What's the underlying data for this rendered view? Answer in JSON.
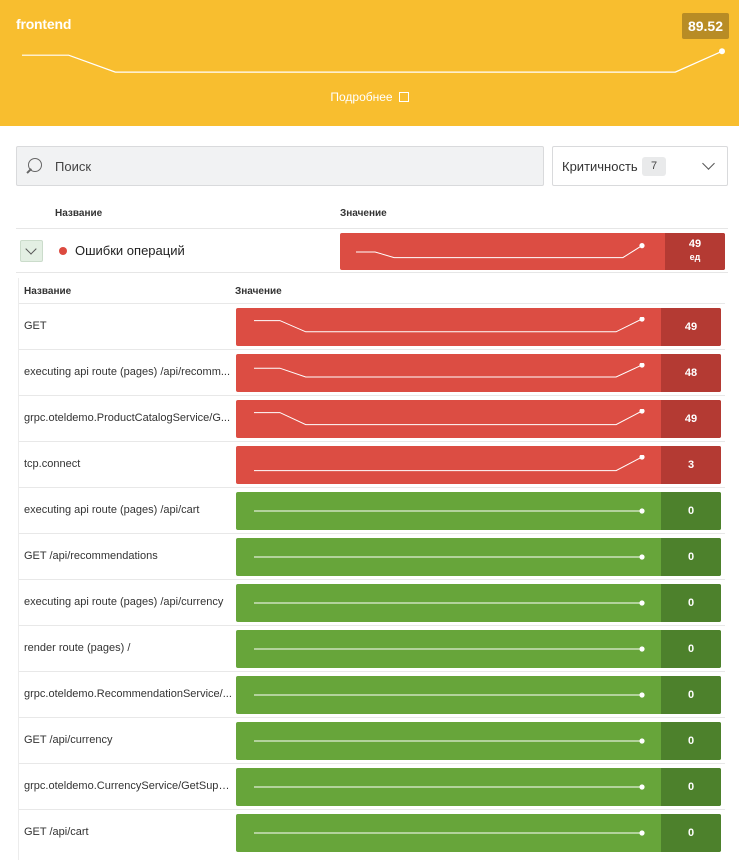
{
  "header": {
    "title": "frontend",
    "score": "89.52",
    "more_link": "Подробнее",
    "sparkline": [
      0.2,
      0.2,
      0.85,
      0.85,
      0.85,
      0.85,
      0.85,
      0.85,
      0.85,
      0.85,
      0.85,
      0.85,
      0.85,
      0.85,
      0.85,
      0.05
    ]
  },
  "filters": {
    "search_placeholder": "Поиск",
    "criticality_label": "Критичность",
    "criticality_count": "7"
  },
  "table": {
    "col_name": "Название",
    "col_value": "Значение",
    "group": {
      "label": "Ошибки операций",
      "value": "49",
      "unit": "ед",
      "status": "error",
      "sparkline": [
        0.5,
        0.5,
        0.85,
        0.85,
        0.85,
        0.85,
        0.85,
        0.85,
        0.85,
        0.85,
        0.85,
        0.85,
        0.85,
        0.85,
        0.85,
        0.1
      ]
    },
    "inner": {
      "col_name": "Название",
      "col_value": "Значение",
      "rows": [
        {
          "name": "GET",
          "value": "49",
          "status": "error",
          "sparkline": [
            0.1,
            0.1,
            0.8,
            0.8,
            0.8,
            0.8,
            0.8,
            0.8,
            0.8,
            0.8,
            0.8,
            0.8,
            0.8,
            0.8,
            0.8,
            0.0
          ]
        },
        {
          "name": "executing api route (pages) /api/recomm...",
          "value": "48",
          "status": "error",
          "sparkline": [
            0.2,
            0.2,
            0.75,
            0.75,
            0.75,
            0.75,
            0.75,
            0.75,
            0.75,
            0.75,
            0.75,
            0.75,
            0.75,
            0.75,
            0.75,
            0.0
          ]
        },
        {
          "name": "grpc.oteldemo.ProductCatalogService/G...",
          "value": "49",
          "status": "error",
          "sparkline": [
            0.1,
            0.1,
            0.85,
            0.85,
            0.85,
            0.85,
            0.85,
            0.85,
            0.85,
            0.85,
            0.85,
            0.85,
            0.85,
            0.85,
            0.85,
            0.0
          ]
        },
        {
          "name": "tcp.connect",
          "value": "3",
          "status": "error",
          "sparkline": [
            0.85,
            0.85,
            0.85,
            0.85,
            0.85,
            0.85,
            0.85,
            0.85,
            0.85,
            0.85,
            0.85,
            0.85,
            0.85,
            0.85,
            0.85,
            0.0
          ]
        },
        {
          "name": "executing api route (pages) /api/cart",
          "value": "0",
          "status": "ok",
          "sparkline": [
            0.5,
            0.5,
            0.5,
            0.5,
            0.5,
            0.5,
            0.5,
            0.5,
            0.5,
            0.5,
            0.5,
            0.5,
            0.5,
            0.5,
            0.5,
            0.5
          ]
        },
        {
          "name": "GET /api/recommendations",
          "value": "0",
          "status": "ok",
          "sparkline": [
            0.5,
            0.5,
            0.5,
            0.5,
            0.5,
            0.5,
            0.5,
            0.5,
            0.5,
            0.5,
            0.5,
            0.5,
            0.5,
            0.5,
            0.5,
            0.5
          ]
        },
        {
          "name": "executing api route (pages) /api/currency",
          "value": "0",
          "status": "ok",
          "sparkline": [
            0.5,
            0.5,
            0.5,
            0.5,
            0.5,
            0.5,
            0.5,
            0.5,
            0.5,
            0.5,
            0.5,
            0.5,
            0.5,
            0.5,
            0.5,
            0.5
          ]
        },
        {
          "name": "render route (pages) /",
          "value": "0",
          "status": "ok",
          "sparkline": [
            0.5,
            0.5,
            0.5,
            0.5,
            0.5,
            0.5,
            0.5,
            0.5,
            0.5,
            0.5,
            0.5,
            0.5,
            0.5,
            0.5,
            0.5,
            0.5
          ]
        },
        {
          "name": "grpc.oteldemo.RecommendationService/...",
          "value": "0",
          "status": "ok",
          "sparkline": [
            0.5,
            0.5,
            0.5,
            0.5,
            0.5,
            0.5,
            0.5,
            0.5,
            0.5,
            0.5,
            0.5,
            0.5,
            0.5,
            0.5,
            0.5,
            0.5
          ]
        },
        {
          "name": "GET /api/currency",
          "value": "0",
          "status": "ok",
          "sparkline": [
            0.5,
            0.5,
            0.5,
            0.5,
            0.5,
            0.5,
            0.5,
            0.5,
            0.5,
            0.5,
            0.5,
            0.5,
            0.5,
            0.5,
            0.5,
            0.5
          ]
        },
        {
          "name": "grpc.oteldemo.CurrencyService/GetSupp...",
          "value": "0",
          "status": "ok",
          "sparkline": [
            0.5,
            0.5,
            0.5,
            0.5,
            0.5,
            0.5,
            0.5,
            0.5,
            0.5,
            0.5,
            0.5,
            0.5,
            0.5,
            0.5,
            0.5,
            0.5
          ]
        },
        {
          "name": "GET /api/cart",
          "value": "0",
          "status": "ok",
          "sparkline": [
            0.5,
            0.5,
            0.5,
            0.5,
            0.5,
            0.5,
            0.5,
            0.5,
            0.5,
            0.5,
            0.5,
            0.5,
            0.5,
            0.5,
            0.5,
            0.5
          ]
        }
      ]
    }
  },
  "colors": {
    "header_bg": "#f8be2f",
    "error": "#dc4d43",
    "error_dark": "#b43a33",
    "ok": "#67a53a",
    "ok_dark": "#4d812c"
  }
}
